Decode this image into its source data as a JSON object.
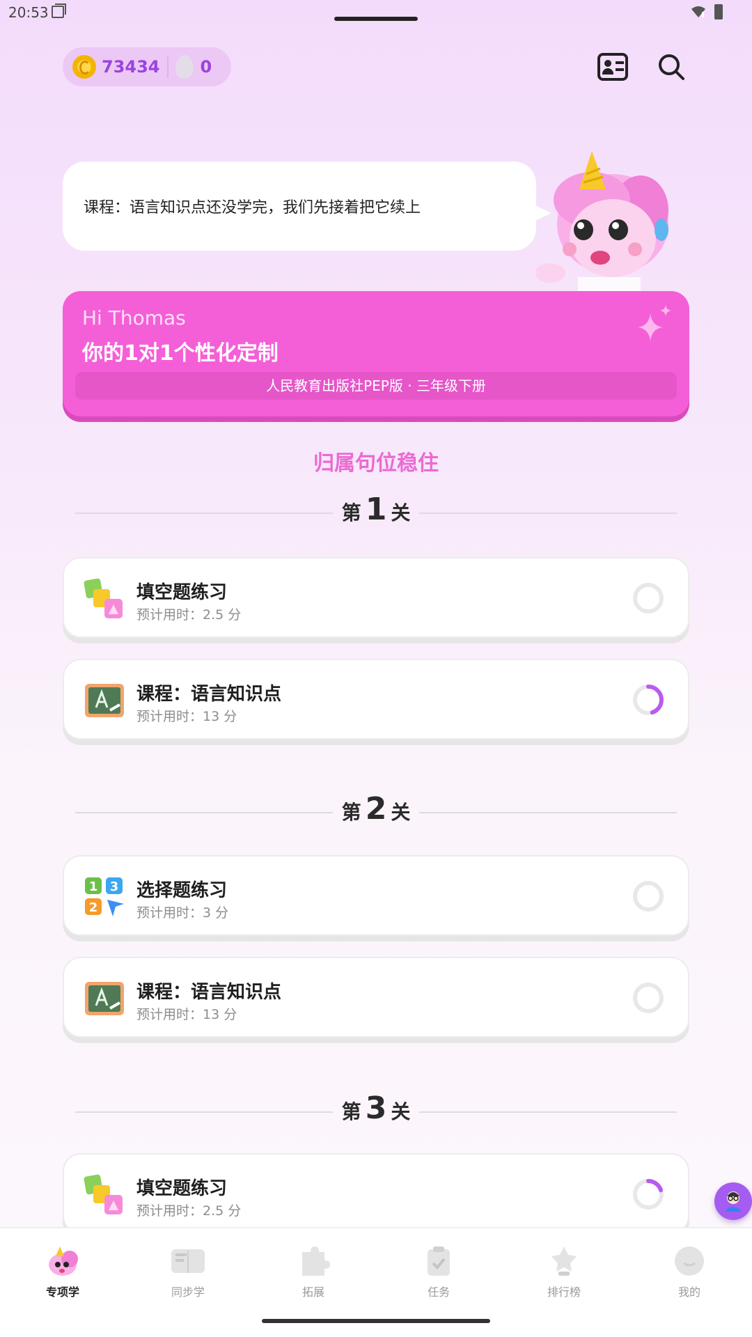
{
  "status_bar": {
    "time": "20:53"
  },
  "header": {
    "coins": "73434",
    "streak": "0"
  },
  "bubble": {
    "text": "课程：语言知识点还没学完，我们先接着把它续上"
  },
  "banner": {
    "greeting": "Hi Thomas",
    "title": "你的1对1个性化定制",
    "subtitle": "人民教育出版社PEP版 · 三年级下册"
  },
  "section": {
    "title": "归属句位稳住"
  },
  "levels": [
    {
      "prefix": "第",
      "number": "1",
      "suffix": "关",
      "items": [
        {
          "title": "填空题练习",
          "meta": "预计用时：2.5 分",
          "icon": "blocks-icon",
          "progress": 0
        },
        {
          "title": "课程：语言知识点",
          "meta": "预计用时：13 分",
          "icon": "chalkboard-icon",
          "progress": 0.45
        }
      ]
    },
    {
      "prefix": "第",
      "number": "2",
      "suffix": "关",
      "items": [
        {
          "title": "选择题练习",
          "meta": "预计用时：3 分",
          "icon": "number-blocks-icon",
          "progress": 0
        },
        {
          "title": "课程：语言知识点",
          "meta": "预计用时：13 分",
          "icon": "chalkboard-icon",
          "progress": 0
        }
      ]
    },
    {
      "prefix": "第",
      "number": "3",
      "suffix": "关",
      "items": [
        {
          "title": "填空题练习",
          "meta": "预计用时：2.5 分",
          "icon": "blocks-icon",
          "progress": 0.2
        }
      ]
    }
  ],
  "nav": [
    {
      "label": "专项学",
      "icon": "unicorn-icon",
      "active": true
    },
    {
      "label": "同步学",
      "icon": "book-icon",
      "active": false
    },
    {
      "label": "拓展",
      "icon": "puzzle-icon",
      "active": false
    },
    {
      "label": "任务",
      "icon": "clipboard-icon",
      "active": false
    },
    {
      "label": "排行榜",
      "icon": "trophy-icon",
      "active": false
    },
    {
      "label": "我的",
      "icon": "face-icon",
      "active": false
    }
  ],
  "colors": {
    "accent": "#f45fd7",
    "progress": "#b85cf0",
    "coin_text": "#9b43e0"
  }
}
